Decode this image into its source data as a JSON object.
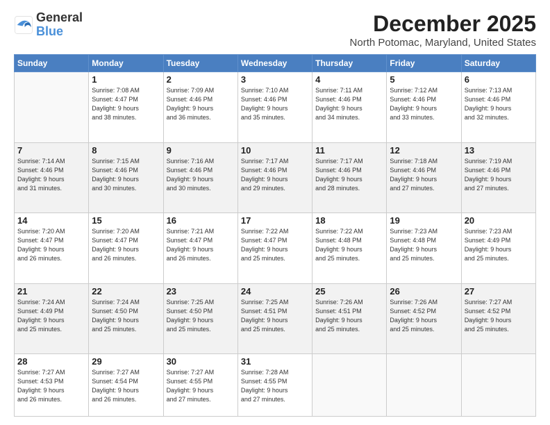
{
  "logo": {
    "line1": "General",
    "line2": "Blue"
  },
  "title": "December 2025",
  "subtitle": "North Potomac, Maryland, United States",
  "headers": [
    "Sunday",
    "Monday",
    "Tuesday",
    "Wednesday",
    "Thursday",
    "Friday",
    "Saturday"
  ],
  "weeks": [
    [
      {
        "day": "",
        "info": ""
      },
      {
        "day": "1",
        "info": "Sunrise: 7:08 AM\nSunset: 4:47 PM\nDaylight: 9 hours\nand 38 minutes."
      },
      {
        "day": "2",
        "info": "Sunrise: 7:09 AM\nSunset: 4:46 PM\nDaylight: 9 hours\nand 36 minutes."
      },
      {
        "day": "3",
        "info": "Sunrise: 7:10 AM\nSunset: 4:46 PM\nDaylight: 9 hours\nand 35 minutes."
      },
      {
        "day": "4",
        "info": "Sunrise: 7:11 AM\nSunset: 4:46 PM\nDaylight: 9 hours\nand 34 minutes."
      },
      {
        "day": "5",
        "info": "Sunrise: 7:12 AM\nSunset: 4:46 PM\nDaylight: 9 hours\nand 33 minutes."
      },
      {
        "day": "6",
        "info": "Sunrise: 7:13 AM\nSunset: 4:46 PM\nDaylight: 9 hours\nand 32 minutes."
      }
    ],
    [
      {
        "day": "7",
        "info": "Sunrise: 7:14 AM\nSunset: 4:46 PM\nDaylight: 9 hours\nand 31 minutes."
      },
      {
        "day": "8",
        "info": "Sunrise: 7:15 AM\nSunset: 4:46 PM\nDaylight: 9 hours\nand 30 minutes."
      },
      {
        "day": "9",
        "info": "Sunrise: 7:16 AM\nSunset: 4:46 PM\nDaylight: 9 hours\nand 30 minutes."
      },
      {
        "day": "10",
        "info": "Sunrise: 7:17 AM\nSunset: 4:46 PM\nDaylight: 9 hours\nand 29 minutes."
      },
      {
        "day": "11",
        "info": "Sunrise: 7:17 AM\nSunset: 4:46 PM\nDaylight: 9 hours\nand 28 minutes."
      },
      {
        "day": "12",
        "info": "Sunrise: 7:18 AM\nSunset: 4:46 PM\nDaylight: 9 hours\nand 27 minutes."
      },
      {
        "day": "13",
        "info": "Sunrise: 7:19 AM\nSunset: 4:46 PM\nDaylight: 9 hours\nand 27 minutes."
      }
    ],
    [
      {
        "day": "14",
        "info": "Sunrise: 7:20 AM\nSunset: 4:47 PM\nDaylight: 9 hours\nand 26 minutes."
      },
      {
        "day": "15",
        "info": "Sunrise: 7:20 AM\nSunset: 4:47 PM\nDaylight: 9 hours\nand 26 minutes."
      },
      {
        "day": "16",
        "info": "Sunrise: 7:21 AM\nSunset: 4:47 PM\nDaylight: 9 hours\nand 26 minutes."
      },
      {
        "day": "17",
        "info": "Sunrise: 7:22 AM\nSunset: 4:47 PM\nDaylight: 9 hours\nand 25 minutes."
      },
      {
        "day": "18",
        "info": "Sunrise: 7:22 AM\nSunset: 4:48 PM\nDaylight: 9 hours\nand 25 minutes."
      },
      {
        "day": "19",
        "info": "Sunrise: 7:23 AM\nSunset: 4:48 PM\nDaylight: 9 hours\nand 25 minutes."
      },
      {
        "day": "20",
        "info": "Sunrise: 7:23 AM\nSunset: 4:49 PM\nDaylight: 9 hours\nand 25 minutes."
      }
    ],
    [
      {
        "day": "21",
        "info": "Sunrise: 7:24 AM\nSunset: 4:49 PM\nDaylight: 9 hours\nand 25 minutes."
      },
      {
        "day": "22",
        "info": "Sunrise: 7:24 AM\nSunset: 4:50 PM\nDaylight: 9 hours\nand 25 minutes."
      },
      {
        "day": "23",
        "info": "Sunrise: 7:25 AM\nSunset: 4:50 PM\nDaylight: 9 hours\nand 25 minutes."
      },
      {
        "day": "24",
        "info": "Sunrise: 7:25 AM\nSunset: 4:51 PM\nDaylight: 9 hours\nand 25 minutes."
      },
      {
        "day": "25",
        "info": "Sunrise: 7:26 AM\nSunset: 4:51 PM\nDaylight: 9 hours\nand 25 minutes."
      },
      {
        "day": "26",
        "info": "Sunrise: 7:26 AM\nSunset: 4:52 PM\nDaylight: 9 hours\nand 25 minutes."
      },
      {
        "day": "27",
        "info": "Sunrise: 7:27 AM\nSunset: 4:52 PM\nDaylight: 9 hours\nand 25 minutes."
      }
    ],
    [
      {
        "day": "28",
        "info": "Sunrise: 7:27 AM\nSunset: 4:53 PM\nDaylight: 9 hours\nand 26 minutes."
      },
      {
        "day": "29",
        "info": "Sunrise: 7:27 AM\nSunset: 4:54 PM\nDaylight: 9 hours\nand 26 minutes."
      },
      {
        "day": "30",
        "info": "Sunrise: 7:27 AM\nSunset: 4:55 PM\nDaylight: 9 hours\nand 27 minutes."
      },
      {
        "day": "31",
        "info": "Sunrise: 7:28 AM\nSunset: 4:55 PM\nDaylight: 9 hours\nand 27 minutes."
      },
      {
        "day": "",
        "info": ""
      },
      {
        "day": "",
        "info": ""
      },
      {
        "day": "",
        "info": ""
      }
    ]
  ]
}
